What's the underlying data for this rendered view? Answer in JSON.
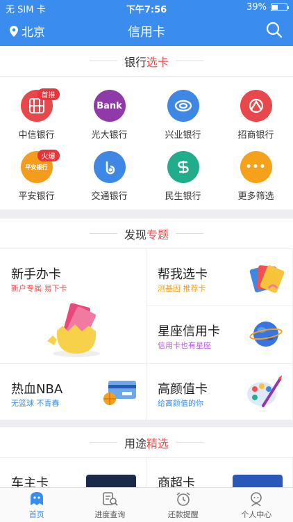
{
  "status": {
    "carrier": "无 SIM 卡",
    "time": "下午7:56",
    "battery": "39%",
    "battery_level": 0.39
  },
  "nav": {
    "city": "北京",
    "title": "信用卡"
  },
  "bank_section": {
    "title_a": "银行",
    "title_b": "选卡"
  },
  "banks": [
    {
      "label": "中信银行",
      "color": "#e8474b",
      "badge": "首推",
      "mark": "",
      "icon": "citic-logo"
    },
    {
      "label": "光大银行",
      "color": "#8f3aa8",
      "badge": "",
      "mark": "Bank",
      "icon": "ceb-logo"
    },
    {
      "label": "兴业银行",
      "color": "#3e87e4",
      "badge": "",
      "mark": "",
      "icon": "cib-logo"
    },
    {
      "label": "招商银行",
      "color": "#e8474b",
      "badge": "",
      "mark": "",
      "icon": "cmb-logo"
    },
    {
      "label": "平安银行",
      "color": "#f39c1e",
      "badge": "火爆",
      "mark": "平安银行",
      "icon": "pingan-logo"
    },
    {
      "label": "交通银行",
      "color": "#3e87e4",
      "badge": "",
      "mark": "",
      "icon": "bocom-logo"
    },
    {
      "label": "民生银行",
      "color": "#21ad8c",
      "badge": "",
      "mark": "",
      "icon": "cmbc-logo"
    },
    {
      "label": "更多筛选",
      "color": "#f6a11a",
      "badge": "",
      "mark": "•••",
      "icon": "more-icon"
    }
  ],
  "topic_section": {
    "title_a": "发现",
    "title_b": "专题"
  },
  "topics": {
    "newbie": {
      "title": "新手办卡",
      "sub": "新户专属 易下卡",
      "sub_color": "#f05050"
    },
    "pick": {
      "title": "帮我选卡",
      "sub": "测基因 推荐卡",
      "sub_color": "#f39c1e"
    },
    "star": {
      "title": "星座信用卡",
      "sub": "信用卡也有星座",
      "sub_color": "#b35ed8"
    },
    "nba": {
      "title": "热血NBA",
      "sub": "无篮球 不青春",
      "sub_color": "#3a8cef"
    },
    "beauty": {
      "title": "高颜值卡",
      "sub": "给高颜值的你",
      "sub_color": "#3a8cef"
    }
  },
  "use_section": {
    "title_a": "用途",
    "title_b": "精选",
    "item1": "车主卡",
    "item2": "商超卡"
  },
  "tabs": [
    {
      "label": "首页"
    },
    {
      "label": "进度查询"
    },
    {
      "label": "还款提醒"
    },
    {
      "label": "个人中心"
    }
  ]
}
